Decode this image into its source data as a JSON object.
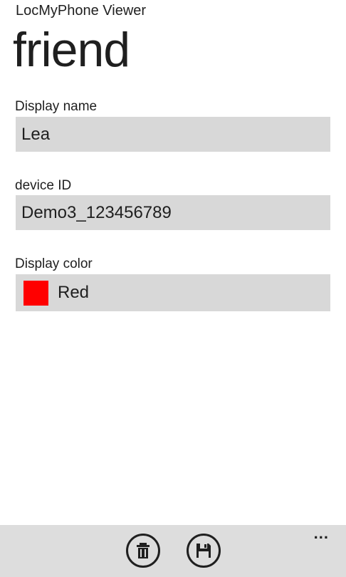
{
  "app": {
    "title": "LocMyPhone Viewer"
  },
  "page": {
    "title": "friend"
  },
  "form": {
    "display_name": {
      "label": "Display name",
      "value": "Lea"
    },
    "device_id": {
      "label": "device ID",
      "value": "Demo3_123456789"
    },
    "display_color": {
      "label": "Display color",
      "value": "Red",
      "swatch": "#ff0000"
    }
  },
  "app_bar": {
    "buttons": [
      {
        "icon": "delete-icon"
      },
      {
        "icon": "save-icon"
      }
    ],
    "more": "..."
  },
  "colors": {
    "background": "#ffffff",
    "field_background": "#d8d8d8",
    "app_bar_background": "#dddddd",
    "text": "#1f1f1f"
  }
}
